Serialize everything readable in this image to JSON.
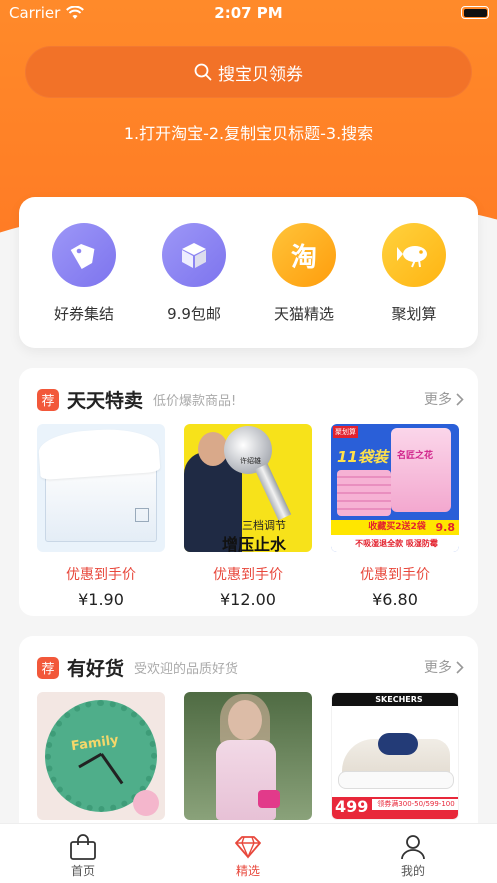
{
  "status": {
    "carrier": "Carrier",
    "time": "2:07 PM"
  },
  "search": {
    "label": "搜宝贝领券"
  },
  "hint": "1.打开淘宝-2.复制宝贝标题-3.搜索",
  "categories": [
    {
      "label": "好券集结",
      "icon": "tag-icon",
      "color": "#8f86f3"
    },
    {
      "label": "9.9包邮",
      "icon": "box-icon",
      "color": "#8f86f3"
    },
    {
      "label": "天猫精选",
      "icon": "taobao-icon",
      "color": "#ffb21e"
    },
    {
      "label": "聚划算",
      "icon": "fish-icon",
      "color": "#ffc21e"
    }
  ],
  "sections": [
    {
      "badge": "荐",
      "title": "天天特卖",
      "subtitle": "低价爆款商品!",
      "more": "更多",
      "products": [
        {
          "promo": "优惠到手价",
          "price": "¥1.90"
        },
        {
          "promo": "优惠到手价",
          "price": "¥12.00"
        },
        {
          "promo": "优惠到手价",
          "price": "¥6.80"
        }
      ]
    },
    {
      "badge": "荐",
      "title": "有好货",
      "subtitle": "受欢迎的品质好货",
      "more": "更多",
      "products": [
        {
          "promo": "",
          "price": ""
        },
        {
          "promo": "",
          "price": ""
        },
        {
          "promo": "",
          "price": ""
        }
      ]
    }
  ],
  "product_texts": {
    "shower_brand_line": "许绍雄",
    "shower_line1": "三档调节",
    "shower_line2": "增压止水",
    "bag_top": "聚划算",
    "bag_big": "11袋装",
    "bag_brand": "名匠之花",
    "bag_strip1": "收藏买2送2袋",
    "bag_strip2": "不吸湿退全款 吸湿防霉",
    "bag_price": "9.8",
    "clock_text": "Family",
    "shoe_brand": "SKECHERS",
    "shoe_price": "499",
    "shoe_coupon": "领券满300-50/599-100"
  },
  "tabs": [
    {
      "label": "首页",
      "icon": "bag-icon"
    },
    {
      "label": "精选",
      "icon": "diamond-icon"
    },
    {
      "label": "我的",
      "icon": "user-icon"
    }
  ],
  "colors": {
    "accent": "#ff7f26",
    "price_red": "#e8483c"
  }
}
